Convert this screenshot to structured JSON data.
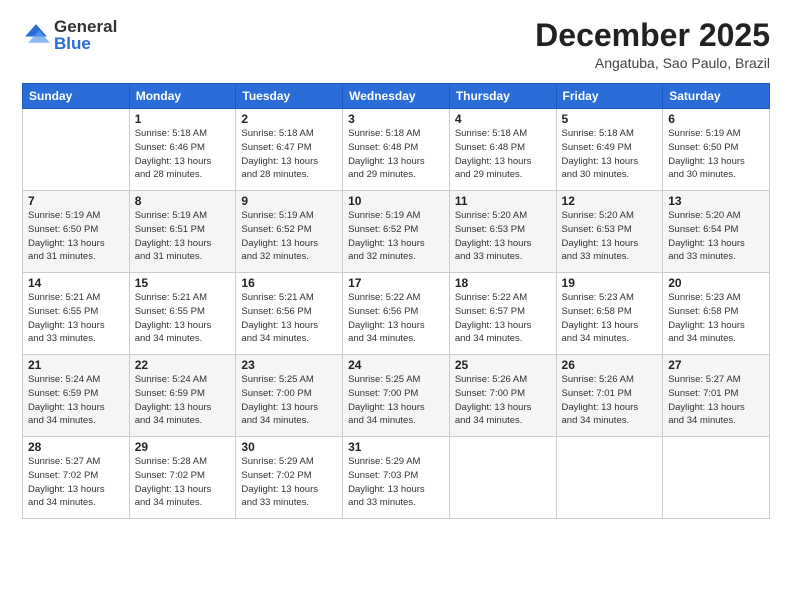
{
  "logo": {
    "general": "General",
    "blue": "Blue"
  },
  "header": {
    "month": "December 2025",
    "location": "Angatuba, Sao Paulo, Brazil"
  },
  "weekdays": [
    "Sunday",
    "Monday",
    "Tuesday",
    "Wednesday",
    "Thursday",
    "Friday",
    "Saturday"
  ],
  "weeks": [
    [
      {
        "day": "",
        "info": ""
      },
      {
        "day": "1",
        "info": "Sunrise: 5:18 AM\nSunset: 6:46 PM\nDaylight: 13 hours\nand 28 minutes."
      },
      {
        "day": "2",
        "info": "Sunrise: 5:18 AM\nSunset: 6:47 PM\nDaylight: 13 hours\nand 28 minutes."
      },
      {
        "day": "3",
        "info": "Sunrise: 5:18 AM\nSunset: 6:48 PM\nDaylight: 13 hours\nand 29 minutes."
      },
      {
        "day": "4",
        "info": "Sunrise: 5:18 AM\nSunset: 6:48 PM\nDaylight: 13 hours\nand 29 minutes."
      },
      {
        "day": "5",
        "info": "Sunrise: 5:18 AM\nSunset: 6:49 PM\nDaylight: 13 hours\nand 30 minutes."
      },
      {
        "day": "6",
        "info": "Sunrise: 5:19 AM\nSunset: 6:50 PM\nDaylight: 13 hours\nand 30 minutes."
      }
    ],
    [
      {
        "day": "7",
        "info": "Sunrise: 5:19 AM\nSunset: 6:50 PM\nDaylight: 13 hours\nand 31 minutes."
      },
      {
        "day": "8",
        "info": "Sunrise: 5:19 AM\nSunset: 6:51 PM\nDaylight: 13 hours\nand 31 minutes."
      },
      {
        "day": "9",
        "info": "Sunrise: 5:19 AM\nSunset: 6:52 PM\nDaylight: 13 hours\nand 32 minutes."
      },
      {
        "day": "10",
        "info": "Sunrise: 5:19 AM\nSunset: 6:52 PM\nDaylight: 13 hours\nand 32 minutes."
      },
      {
        "day": "11",
        "info": "Sunrise: 5:20 AM\nSunset: 6:53 PM\nDaylight: 13 hours\nand 33 minutes."
      },
      {
        "day": "12",
        "info": "Sunrise: 5:20 AM\nSunset: 6:53 PM\nDaylight: 13 hours\nand 33 minutes."
      },
      {
        "day": "13",
        "info": "Sunrise: 5:20 AM\nSunset: 6:54 PM\nDaylight: 13 hours\nand 33 minutes."
      }
    ],
    [
      {
        "day": "14",
        "info": "Sunrise: 5:21 AM\nSunset: 6:55 PM\nDaylight: 13 hours\nand 33 minutes."
      },
      {
        "day": "15",
        "info": "Sunrise: 5:21 AM\nSunset: 6:55 PM\nDaylight: 13 hours\nand 34 minutes."
      },
      {
        "day": "16",
        "info": "Sunrise: 5:21 AM\nSunset: 6:56 PM\nDaylight: 13 hours\nand 34 minutes."
      },
      {
        "day": "17",
        "info": "Sunrise: 5:22 AM\nSunset: 6:56 PM\nDaylight: 13 hours\nand 34 minutes."
      },
      {
        "day": "18",
        "info": "Sunrise: 5:22 AM\nSunset: 6:57 PM\nDaylight: 13 hours\nand 34 minutes."
      },
      {
        "day": "19",
        "info": "Sunrise: 5:23 AM\nSunset: 6:58 PM\nDaylight: 13 hours\nand 34 minutes."
      },
      {
        "day": "20",
        "info": "Sunrise: 5:23 AM\nSunset: 6:58 PM\nDaylight: 13 hours\nand 34 minutes."
      }
    ],
    [
      {
        "day": "21",
        "info": "Sunrise: 5:24 AM\nSunset: 6:59 PM\nDaylight: 13 hours\nand 34 minutes."
      },
      {
        "day": "22",
        "info": "Sunrise: 5:24 AM\nSunset: 6:59 PM\nDaylight: 13 hours\nand 34 minutes."
      },
      {
        "day": "23",
        "info": "Sunrise: 5:25 AM\nSunset: 7:00 PM\nDaylight: 13 hours\nand 34 minutes."
      },
      {
        "day": "24",
        "info": "Sunrise: 5:25 AM\nSunset: 7:00 PM\nDaylight: 13 hours\nand 34 minutes."
      },
      {
        "day": "25",
        "info": "Sunrise: 5:26 AM\nSunset: 7:00 PM\nDaylight: 13 hours\nand 34 minutes."
      },
      {
        "day": "26",
        "info": "Sunrise: 5:26 AM\nSunset: 7:01 PM\nDaylight: 13 hours\nand 34 minutes."
      },
      {
        "day": "27",
        "info": "Sunrise: 5:27 AM\nSunset: 7:01 PM\nDaylight: 13 hours\nand 34 minutes."
      }
    ],
    [
      {
        "day": "28",
        "info": "Sunrise: 5:27 AM\nSunset: 7:02 PM\nDaylight: 13 hours\nand 34 minutes."
      },
      {
        "day": "29",
        "info": "Sunrise: 5:28 AM\nSunset: 7:02 PM\nDaylight: 13 hours\nand 34 minutes."
      },
      {
        "day": "30",
        "info": "Sunrise: 5:29 AM\nSunset: 7:02 PM\nDaylight: 13 hours\nand 33 minutes."
      },
      {
        "day": "31",
        "info": "Sunrise: 5:29 AM\nSunset: 7:03 PM\nDaylight: 13 hours\nand 33 minutes."
      },
      {
        "day": "",
        "info": ""
      },
      {
        "day": "",
        "info": ""
      },
      {
        "day": "",
        "info": ""
      }
    ]
  ]
}
